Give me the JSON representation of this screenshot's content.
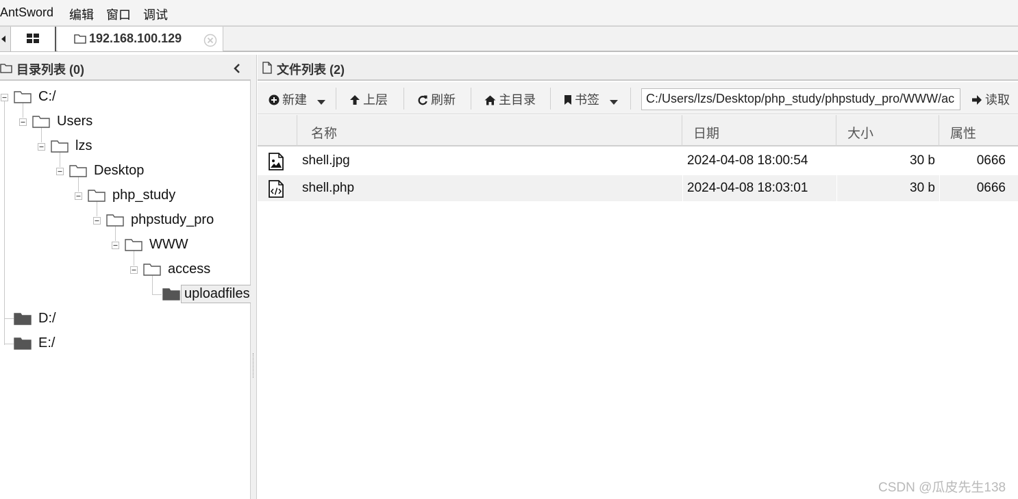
{
  "menu": {
    "app": "AntSword",
    "edit": "编辑",
    "window": "窗口",
    "debug": "调试"
  },
  "tabs": {
    "host": "192.168.100.129"
  },
  "left_pane": {
    "title": "目录列表 (0)",
    "tree": {
      "c": "C:/",
      "users": "Users",
      "lzs": "lzs",
      "desktop": "Desktop",
      "php_study": "php_study",
      "phpstudy_pro": "phpstudy_pro",
      "www": "WWW",
      "access": "access",
      "uploadfiles": "uploadfiles",
      "d": "D:/",
      "e": "E:/"
    }
  },
  "right_pane": {
    "title": "文件列表 (2)",
    "toolbar": {
      "new": "新建",
      "up": "上层",
      "refresh": "刷新",
      "home": "主目录",
      "bookmark": "书签",
      "path": "C:/Users/lzs/Desktop/php_study/phpstudy_pro/WWW/ac",
      "read": "读取"
    },
    "columns": {
      "name": "名称",
      "date": "日期",
      "size": "大小",
      "attr": "属性"
    },
    "files": [
      {
        "name": "shell.jpg",
        "date": "2024-04-08 18:00:54",
        "size": "30 b",
        "attr": "0666",
        "icon": "image-file-icon"
      },
      {
        "name": "shell.php",
        "date": "2024-04-08 18:03:01",
        "size": "30 b",
        "attr": "0666",
        "icon": "code-file-icon"
      }
    ]
  },
  "watermark": "CSDN @瓜皮先生138"
}
